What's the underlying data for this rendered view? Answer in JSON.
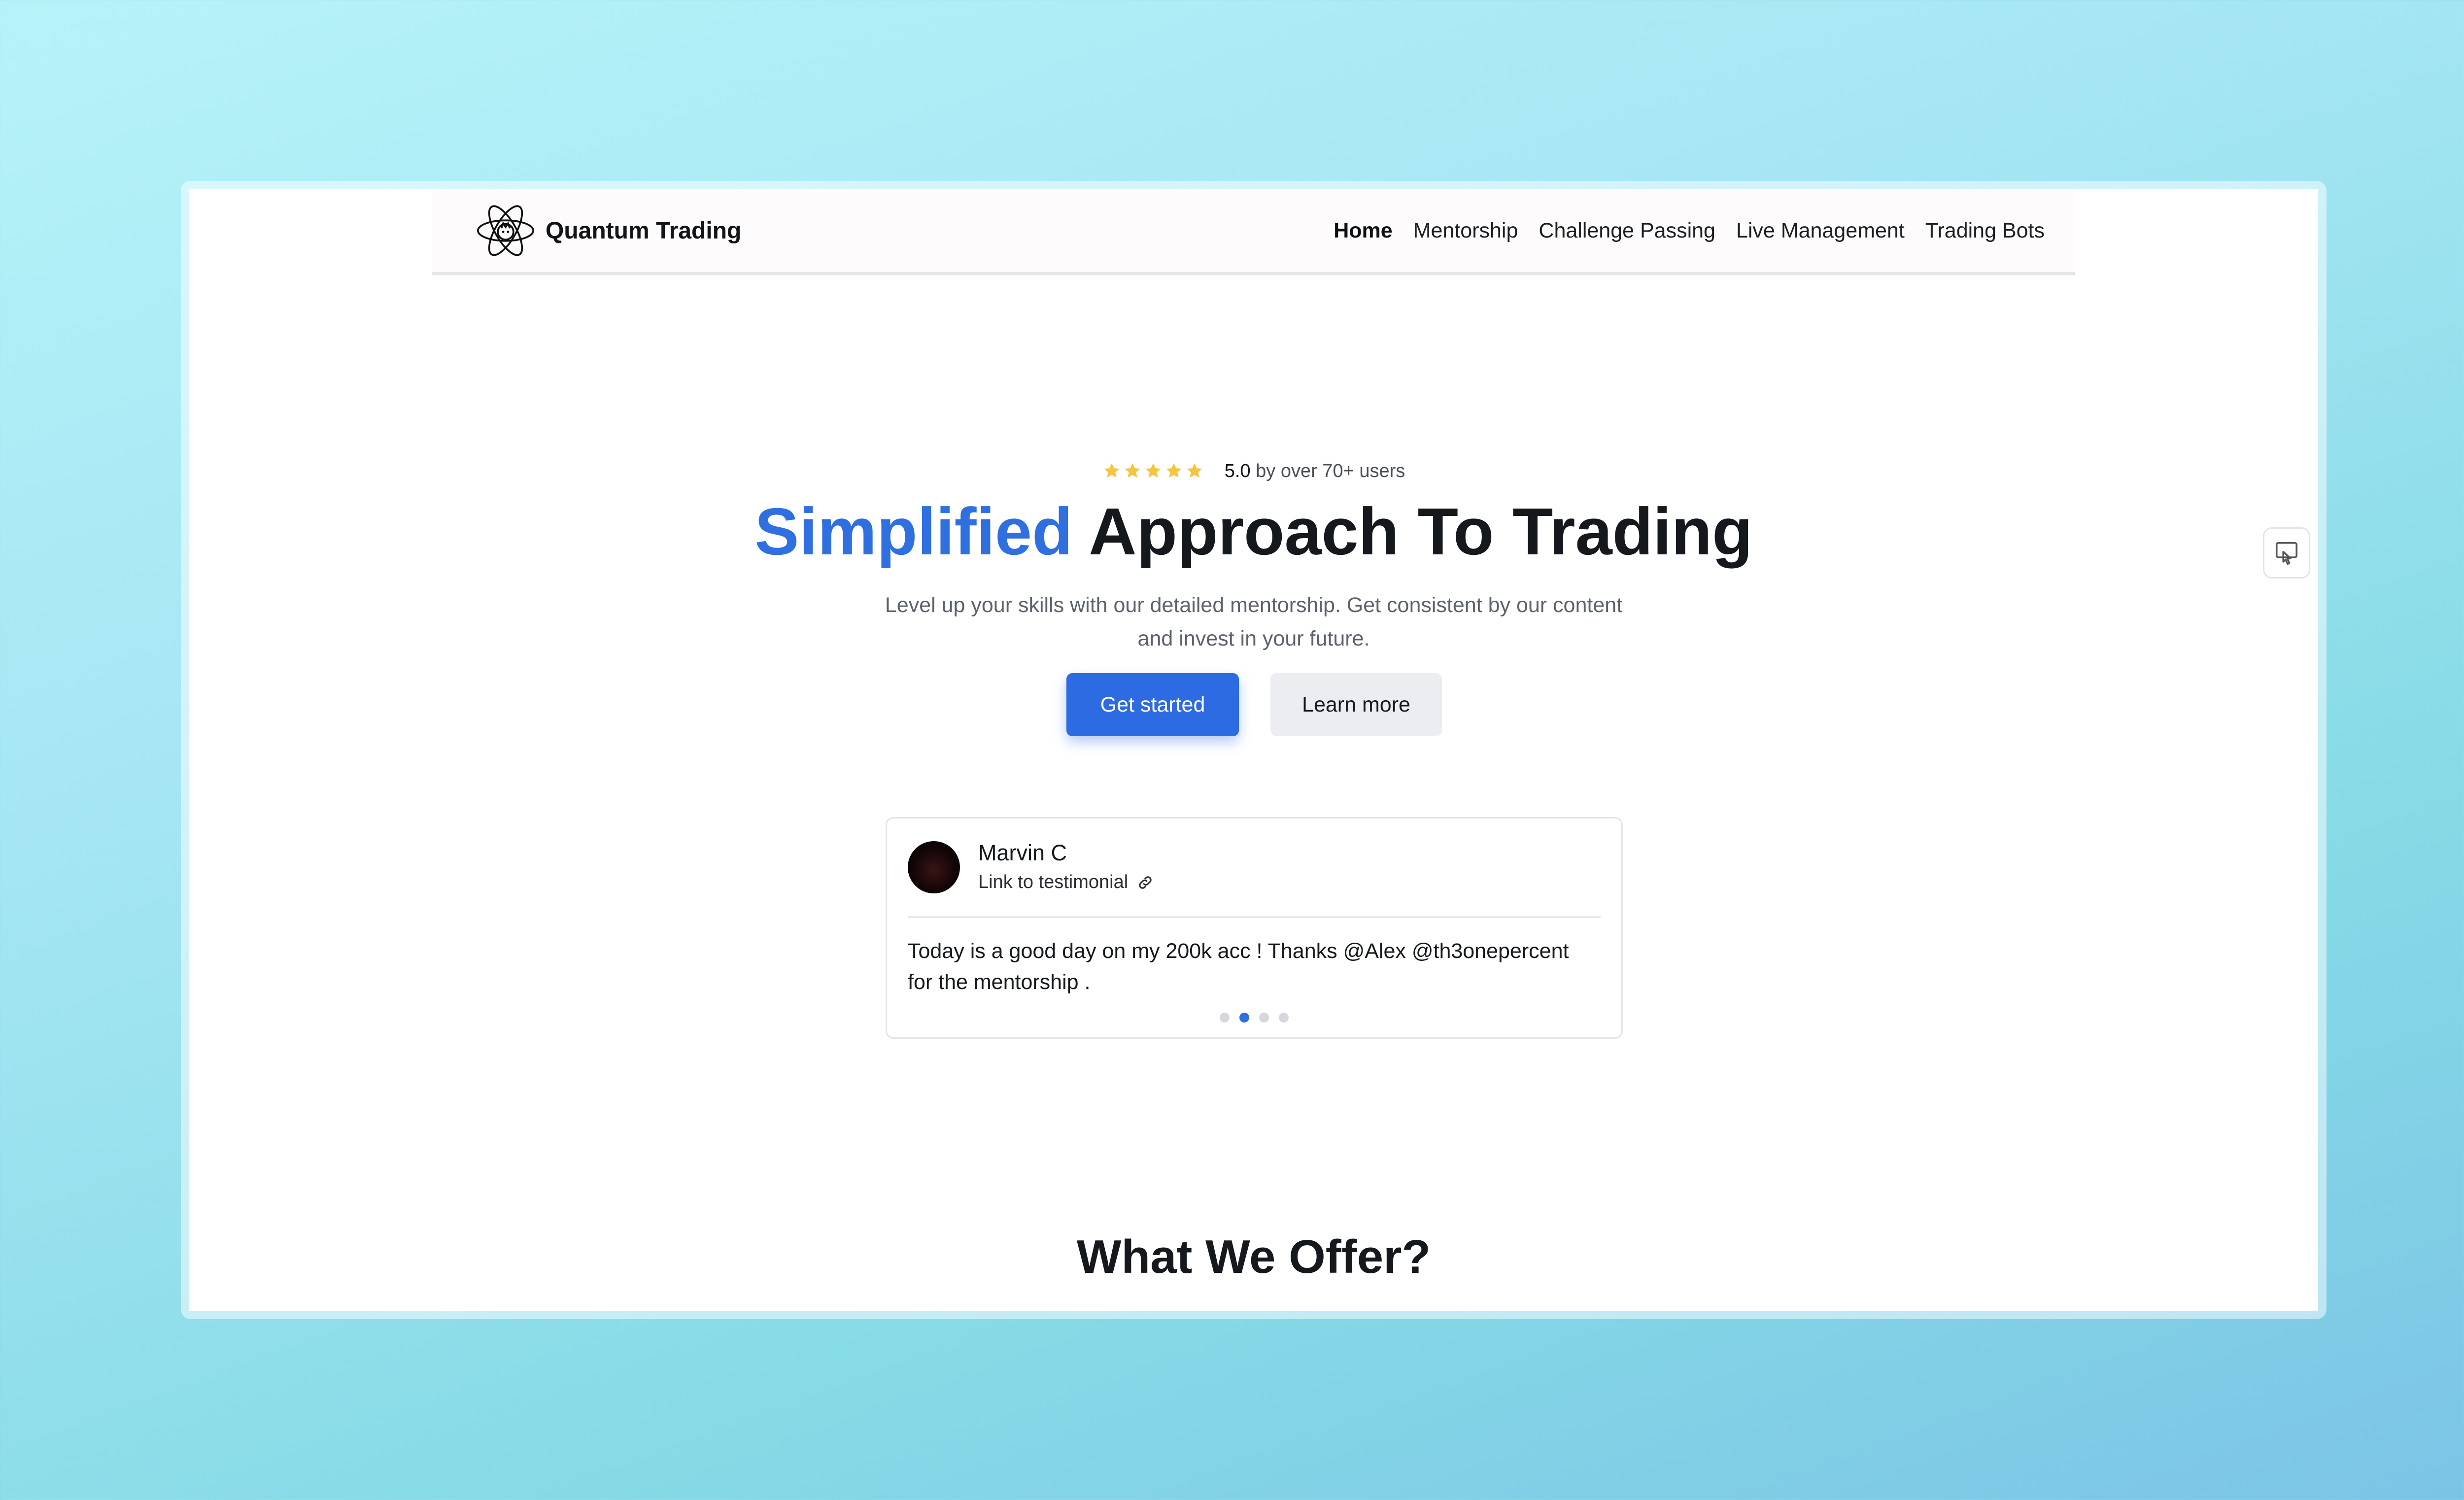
{
  "brand": {
    "name": "Quantum Trading",
    "logo": "atom-logo-icon"
  },
  "nav": {
    "items": [
      {
        "label": "Home",
        "active": true
      },
      {
        "label": "Mentorship",
        "active": false
      },
      {
        "label": "Challenge Passing",
        "active": false
      },
      {
        "label": "Live Management",
        "active": false
      },
      {
        "label": "Trading Bots",
        "active": false
      }
    ]
  },
  "rating": {
    "stars": 5,
    "score": "5.0",
    "text": " by over 70+ users",
    "star_color": "#f5c542"
  },
  "hero": {
    "title_accent": "Simplified",
    "title_rest": " Approach To Trading",
    "subtitle": "Level up your skills with our detailed mentorship. Get consistent by our content and invest in your future.",
    "primary_button": "Get started",
    "secondary_button": "Learn more"
  },
  "testimonial": {
    "author": "Marvin C",
    "link_label": "Link to testimonial",
    "quote": "Today is a good day on my 200k acc ! Thanks @Alex @th3onepercent for the mentorship .",
    "slides": 4,
    "active_slide": 1
  },
  "offer": {
    "title": "What We Offer?"
  },
  "colors": {
    "accent": "#2f6fe0",
    "primary_button": "#2d6be3"
  }
}
